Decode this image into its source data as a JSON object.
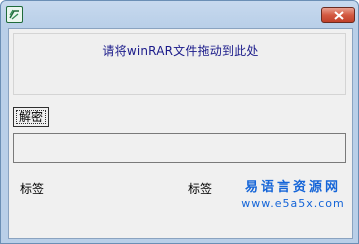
{
  "window": {
    "close_label": "×"
  },
  "drop_panel": {
    "hint": "请将winRAR文件拖动到此处"
  },
  "buttons": {
    "decrypt_label": "解密"
  },
  "text_field": {
    "value": ""
  },
  "labels": {
    "label1": "标签",
    "label2": "标签"
  },
  "watermark": {
    "line1": "易语言资源网",
    "line2": "www.e5a5x.com"
  },
  "colors": {
    "hint_text": "#1a1a8a",
    "watermark": "#1565d8",
    "close_button": "#c94a34"
  },
  "icons": {
    "app": "app-icon",
    "close": "close-icon"
  }
}
